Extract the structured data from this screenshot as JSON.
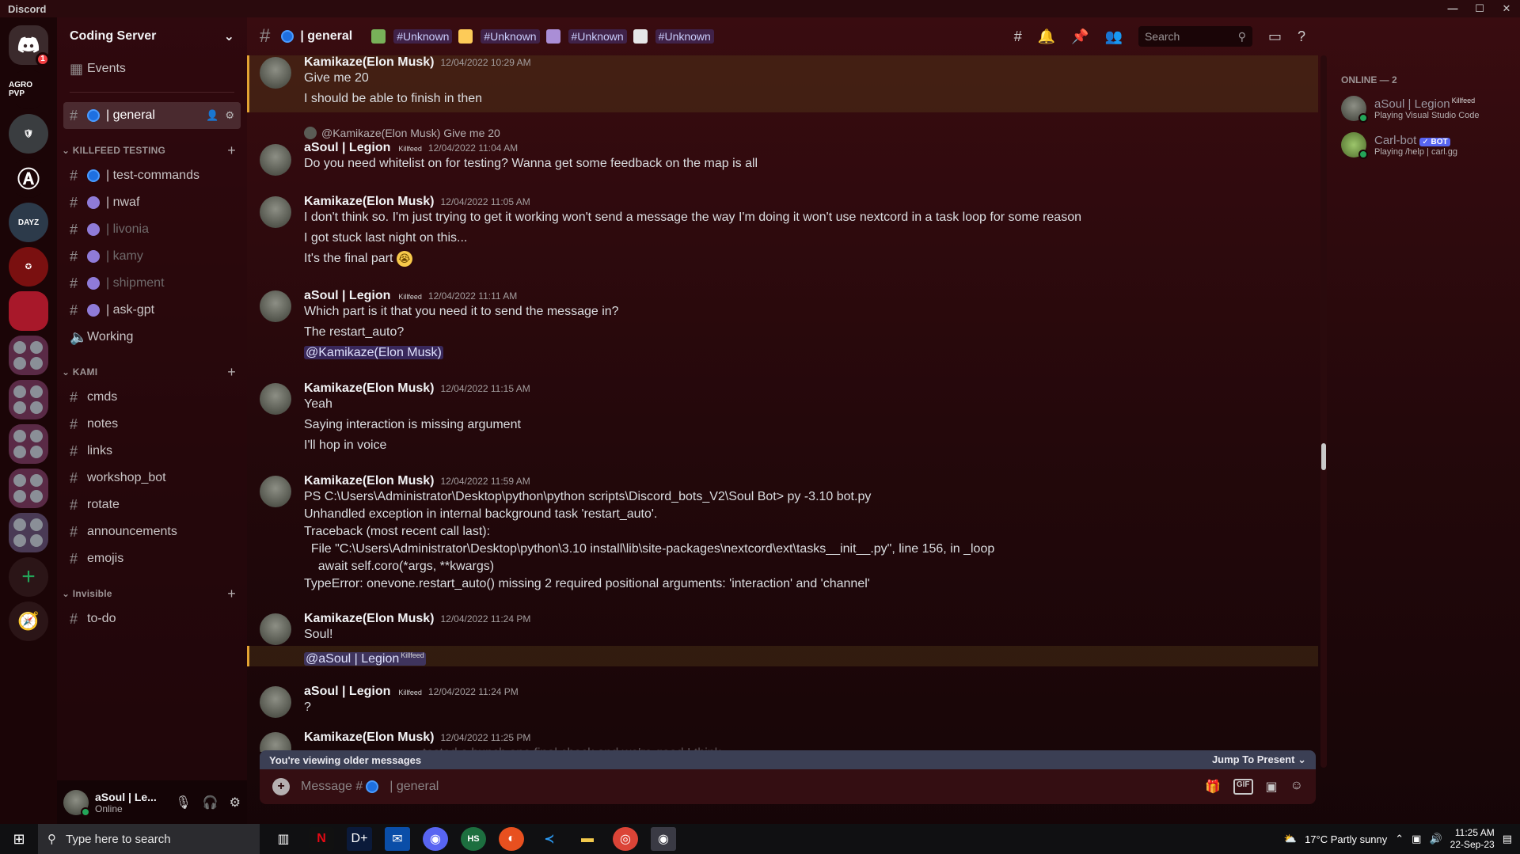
{
  "window": {
    "title": "Discord"
  },
  "rail": {
    "home_badge": "1",
    "labels": [
      "AGRO PVP",
      "DAYZ"
    ]
  },
  "server": {
    "name": "Coding Server"
  },
  "sidebar": {
    "events": "Events",
    "active_channel": "| general",
    "categories": [
      {
        "name": "KILLFEED TESTING",
        "channels": [
          "| test-commands",
          "| nwaf",
          "| livonia",
          "| kamy",
          "| shipment",
          "| ask-gpt"
        ],
        "voice": "Working"
      },
      {
        "name": "KAMI",
        "channels": [
          "cmds",
          "notes",
          "links",
          "workshop_bot",
          "rotate",
          "announcements",
          "emojis"
        ]
      },
      {
        "name": "Invisible",
        "channels": [
          "to-do"
        ]
      }
    ]
  },
  "user_panel": {
    "name": "aSoul | Le...",
    "status": "Online"
  },
  "topbar": {
    "channel": "| general",
    "tags": [
      "#Unknown",
      "#Unknown",
      "#Unknown",
      "#Unknown"
    ],
    "search_placeholder": "Search"
  },
  "messages": [
    {
      "author": "Kamikaze(Elon Musk)",
      "time": "12/04/2022 10:29 AM",
      "lines": [
        "Give me 20",
        "I should be able to finish in then"
      ]
    },
    {
      "reply": "@Kamikaze(Elon Musk) Give me 20",
      "author": "aSoul | Legion",
      "tag": "Killfeed",
      "time": "12/04/2022 11:04 AM",
      "lines": [
        "Do you need whitelist on for testing? Wanna get some feedback on the map is all"
      ]
    },
    {
      "author": "Kamikaze(Elon Musk)",
      "time": "12/04/2022 11:05 AM",
      "lines": [
        "I don't think so. I'm just trying to get it working won't send a message the way I'm doing it won't use nextcord in a task loop for some reason",
        "I got stuck last night on this...",
        "It's the final part"
      ]
    },
    {
      "author": "aSoul | Legion",
      "tag": "Killfeed",
      "time": "12/04/2022 11:11 AM",
      "lines": [
        "Which part is it that you need it to send the message in?",
        "The restart_auto?"
      ],
      "mention": "@Kamikaze(Elon Musk)"
    },
    {
      "author": "Kamikaze(Elon Musk)",
      "time": "12/04/2022 11:15 AM",
      "lines": [
        "Yeah",
        "Saying interaction is missing argument",
        "I'll hop in voice"
      ]
    },
    {
      "author": "Kamikaze(Elon Musk)",
      "time": "12/04/2022 11:59 AM",
      "lines": [
        "PS C:\\Users\\Administrator\\Desktop\\python\\python scripts\\Discord_bots_V2\\Soul Bot> py -3.10 bot.py",
        "Unhandled exception in internal background task 'restart_auto'.",
        "Traceback (most recent call last):",
        "  File \"C:\\Users\\Administrator\\Desktop\\python\\3.10 install\\lib\\site-packages\\nextcord\\ext\\tasks__init__.py\", line 156, in _loop",
        "    await self.coro(*args, **kwargs)",
        "TypeError: onevone.restart_auto() missing 2 required positional arguments: 'interaction' and 'channel'"
      ]
    },
    {
      "author": "Kamikaze(Elon Musk)",
      "time": "12/04/2022 11:24 PM",
      "lines": [
        "Soul!"
      ],
      "mention": "@aSoul | Legion",
      "mention_tag": "Killfeed"
    },
    {
      "author": "aSoul | Legion",
      "tag": "Killfeed",
      "time": "12/04/2022 11:24 PM",
      "lines": [
        "?"
      ]
    },
    {
      "author": "Kamikaze(Elon Musk)",
      "time": "12/04/2022 11:25 PM",
      "lines": [
        "tested a bunch one final check and we're good I think."
      ]
    }
  ],
  "older_bar": {
    "label": "You're viewing older messages",
    "jump": "Jump To Present"
  },
  "composer": {
    "placeholder": "Message #",
    "channel": "| general",
    "gif": "GIF"
  },
  "members": {
    "heading": "ONLINE — 2",
    "list": [
      {
        "name": "aSoul | Legion",
        "tag": "Killfeed",
        "activity": "Playing Visual Studio Code"
      },
      {
        "name": "Carl-bot",
        "badge": "✓ BOT",
        "activity": "Playing /help | carl.gg"
      }
    ]
  },
  "taskbar": {
    "search": "Type here to search",
    "weather": "17°C  Partly sunny",
    "time": "11:25 AM",
    "date": "22-Sep-23",
    "apps": [
      "HS"
    ]
  }
}
